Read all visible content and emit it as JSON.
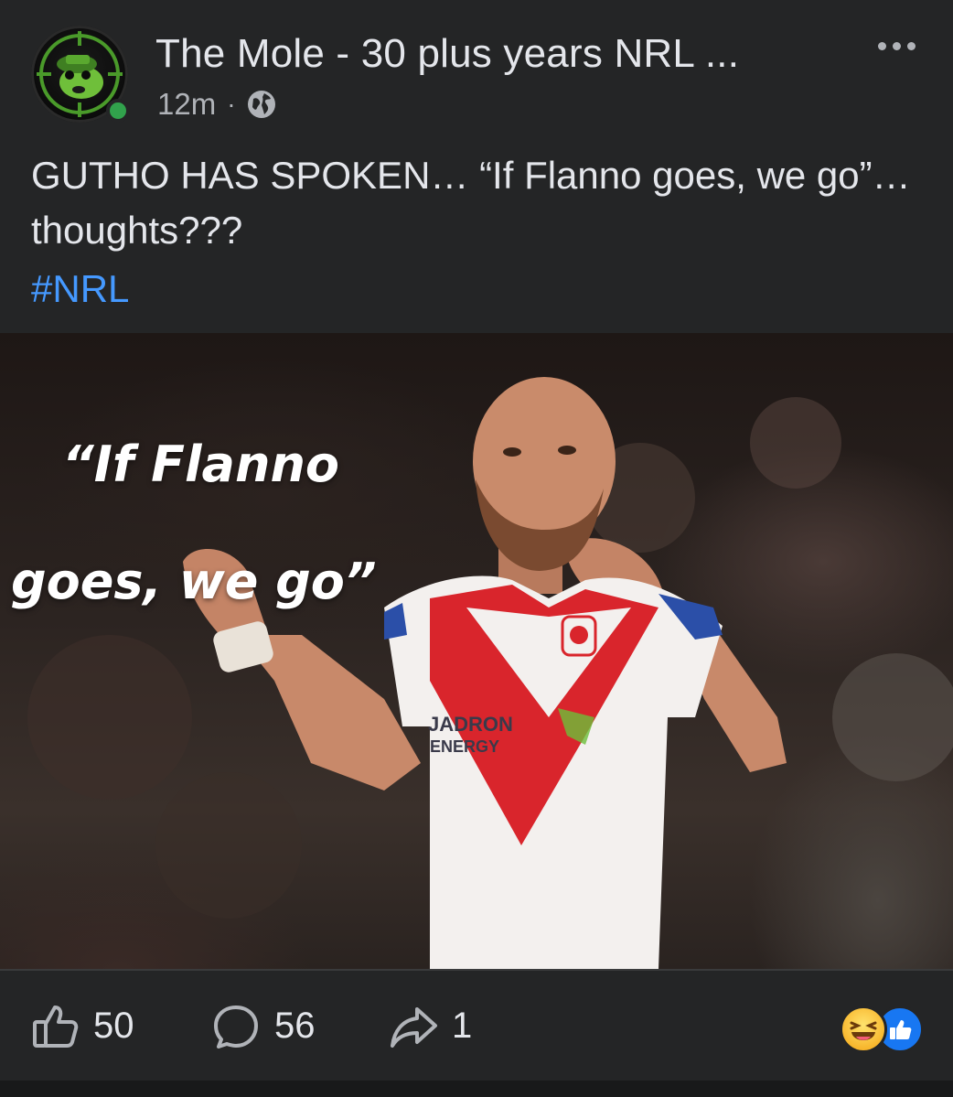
{
  "post": {
    "page_name": "The Mole - 30 plus years NRL ...",
    "time": "12m",
    "separator": "·",
    "privacy_icon": "globe-icon",
    "more_icon": "more-dots-icon",
    "caption": "GUTHO HAS SPOKEN… “If Flanno goes, we go”… thoughts???",
    "hashtag": "#NRL",
    "online_status_color": "#31a24c"
  },
  "image": {
    "overlay_line1": "“If Flanno",
    "overlay_line2": "goes, we go”",
    "jersey_sponsor_line1": "JADRON",
    "jersey_sponsor_line2": "ENERGY"
  },
  "actions": {
    "like_count": "50",
    "comment_count": "56",
    "share_count": "1",
    "like_icon": "thumbs-up-icon",
    "comment_icon": "comment-bubble-icon",
    "share_icon": "share-arrow-icon",
    "reactions": [
      "haha-reaction",
      "like-reaction"
    ]
  },
  "colors": {
    "background": "#242526",
    "text": "#e4e6eb",
    "muted": "#b0b3b8",
    "hashtag": "#4599ff",
    "like_blue": "#1877f2"
  }
}
